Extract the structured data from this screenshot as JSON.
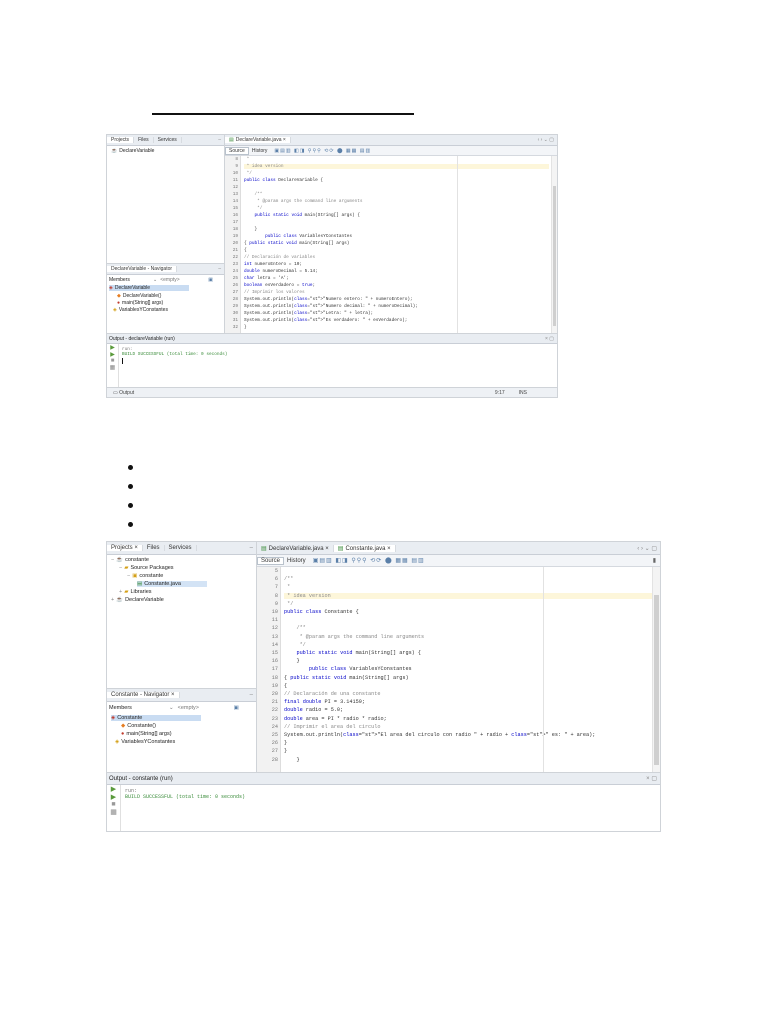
{
  "ide1": {
    "left_tabs": [
      "Projects",
      "Files",
      "Services"
    ],
    "project_tree": [
      "DeclareVariable"
    ],
    "navigator_title": "DeclareVariable - Navigator",
    "navigator_members_label": "Members",
    "navigator_filter": "<empty>",
    "navigator_items": [
      "DeclareVariable",
      "DeclareVariable()",
      "main(String[] args)",
      "VariablesYConstantes"
    ],
    "editor_tab": "DeclareVariable.java",
    "source_tab": "Source",
    "history_tab": "History",
    "code_lines": [
      {
        "n": "8",
        "t": " *"
      },
      {
        "n": "9",
        "t": " * idea version"
      },
      {
        "n": "10",
        "t": " */"
      },
      {
        "n": "11",
        "t": "public class DeclareVariable {"
      },
      {
        "n": "12",
        "t": ""
      },
      {
        "n": "13",
        "t": "    /**"
      },
      {
        "n": "14",
        "t": "     * @param args the command line arguments"
      },
      {
        "n": "15",
        "t": "     */"
      },
      {
        "n": "16",
        "t": "    public static void main(String[] args) {"
      },
      {
        "n": "17",
        "t": ""
      },
      {
        "n": "18",
        "t": "    }"
      },
      {
        "n": "19",
        "t": "        public class VariablesYConstantes"
      },
      {
        "n": "20",
        "t": "{ public static void main(String[] args)"
      },
      {
        "n": "21",
        "t": "{"
      },
      {
        "n": "22",
        "t": "// Declaración de variables"
      },
      {
        "n": "23",
        "t": "int numeroEntero = 10;"
      },
      {
        "n": "24",
        "t": "double numeroDecimal = 5.14;"
      },
      {
        "n": "25",
        "t": "char letra = 'A';"
      },
      {
        "n": "26",
        "t": "boolean esVerdadero = true;"
      },
      {
        "n": "27",
        "t": "// Imprimir los valores"
      },
      {
        "n": "28",
        "t": "System.out.println(\"Numero entero: \" + numeroEntero);"
      },
      {
        "n": "29",
        "t": "System.out.println(\"Numero decimal: \" + numeroDecimal);"
      },
      {
        "n": "30",
        "t": "System.out.println(\"Letra: \" + letra);"
      },
      {
        "n": "31",
        "t": "System.out.println(\"Es verdadero: \" + esVerdadero);"
      },
      {
        "n": "32",
        "t": "}"
      }
    ],
    "output_title": "Output - declareVariable (run)",
    "output_lines": [
      "run:",
      "BUILD SUCCESSFUL (total time: 0 seconds)"
    ],
    "status_output": "Output",
    "status_pos": "9:17",
    "status_mode": "INS"
  },
  "ide2": {
    "left_tabs": [
      "Projects",
      "Files",
      "Services"
    ],
    "project_tree": [
      "constante",
      "Source Packages",
      "constante",
      "Constante.java",
      "Libraries",
      "DeclareVariable"
    ],
    "navigator_title": "Constante - Navigator",
    "navigator_members_label": "Members",
    "navigator_filter": "<empty>",
    "navigator_items": [
      "Constante",
      "Constante()",
      "main(String[] args)",
      "VariablesYConstantes"
    ],
    "editor_tabs": [
      "DeclareVariable.java",
      "Constante.java"
    ],
    "source_tab": "Source",
    "history_tab": "History",
    "code_lines": [
      {
        "n": "5",
        "t": ""
      },
      {
        "n": "6",
        "t": "/**"
      },
      {
        "n": "7",
        "t": " *"
      },
      {
        "n": "8",
        "t": " * idea version"
      },
      {
        "n": "9",
        "t": " */"
      },
      {
        "n": "10",
        "t": "public class Constante {"
      },
      {
        "n": "11",
        "t": ""
      },
      {
        "n": "12",
        "t": "    /**"
      },
      {
        "n": "13",
        "t": "     * @param args the command line arguments"
      },
      {
        "n": "14",
        "t": "     */"
      },
      {
        "n": "15",
        "t": "    public static void main(String[] args) {"
      },
      {
        "n": "16",
        "t": "    }"
      },
      {
        "n": "17",
        "t": "        public class VariablesYConstantes"
      },
      {
        "n": "18",
        "t": "{ public static void main(String[] args)"
      },
      {
        "n": "19",
        "t": "{"
      },
      {
        "n": "20",
        "t": "// Declaración de una constante"
      },
      {
        "n": "21",
        "t": "final double PI = 3.14159;"
      },
      {
        "n": "22",
        "t": "double radio = 5.0;"
      },
      {
        "n": "23",
        "t": "double area = PI * radio * radio;"
      },
      {
        "n": "24",
        "t": "// Imprimir el area del circulo"
      },
      {
        "n": "25",
        "t": "System.out.println(\"El area del circulo con radio \" + radio + \" es: \" + area);"
      },
      {
        "n": "26",
        "t": "}"
      },
      {
        "n": "27",
        "t": "}"
      },
      {
        "n": "28",
        "t": "    }"
      }
    ],
    "output_title": "Output - constante (run)",
    "output_lines": [
      "run:",
      "BUILD SUCCESSFUL (total time: 0 seconds)"
    ]
  }
}
